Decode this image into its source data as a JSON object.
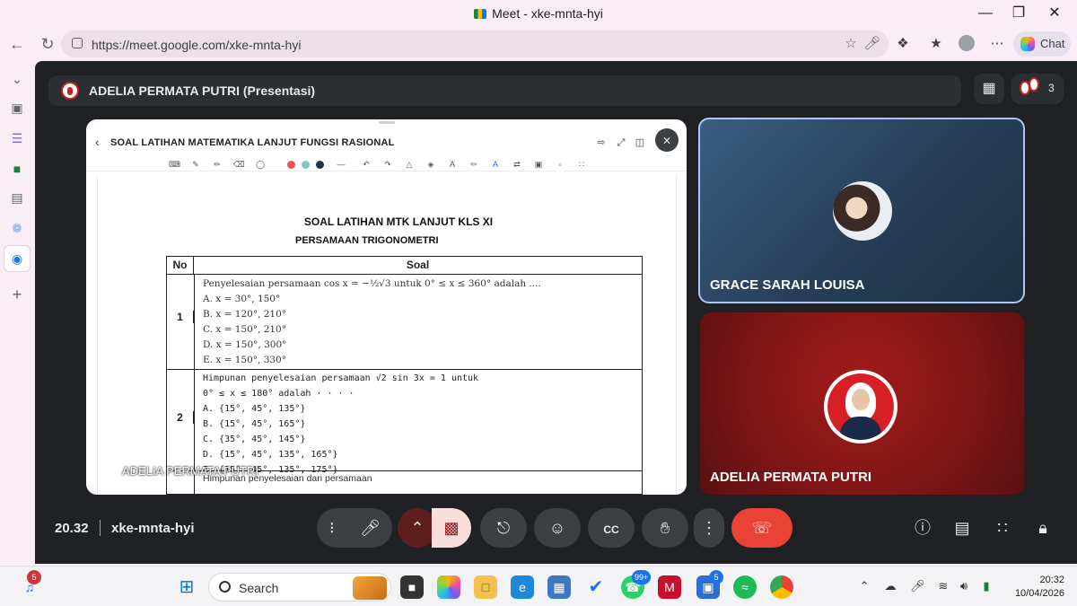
{
  "browser": {
    "tab_title": "Meet - xke-mnta-hyi",
    "url": "https://meet.google.com/xke-mnta-hyi",
    "chat_label": "Chat"
  },
  "meet": {
    "presenter_bar_title": "ADELIA PERMATA PUTRI (Presentasi)",
    "participant_count": "3",
    "time": "20.32",
    "meeting_code": "xke-mnta-hyi",
    "presentation_label": "ADELIA PERMATA PUTRI"
  },
  "document": {
    "title": "SOAL LATIHAN  MATEMATIKA LANJUT FUNGSI RASIONAL",
    "heading": "SOAL LATIHAN  MTK LANJUT KLS  XI",
    "subheading": "PERSAMAAN TRIGONOMETRI",
    "table_headers": {
      "no": "No",
      "soal": "Soal"
    },
    "questions": [
      {
        "no": "1",
        "stem": "Penyelesaian persamaan cos x = −½√3 untuk 0° ≤ x ≤ 360° adalah ....",
        "options": [
          "A. x = 30°, 150°",
          "B. x = 120°, 210°",
          "C. x = 150°, 210°",
          "D. x = 150°, 300°",
          "E. x = 150°, 330°"
        ]
      },
      {
        "no": "2",
        "stem": "Himpunan penyelesaian persamaan √2 sin 3x = 1 untuk",
        "stem2": "0° ≤ x ≤ 180° adalah · · · ·",
        "options": [
          "A. {15°, 45°, 135°}",
          "B. {15°, 45°, 165°}",
          "C. {35°, 45°, 145°}",
          "D. {15°, 45°, 135°, 165°}",
          "E. {15°, 45°, 135°, 175°}"
        ]
      }
    ],
    "next_question_fragment": "Himpunan penyelesaian dari persamaan",
    "pen_colors": [
      "#e8534f",
      "#7fc8c0",
      "#1f2f4a"
    ]
  },
  "tiles": [
    {
      "name": "GRACE SARAH LOUISA"
    },
    {
      "name": "ADELIA PERMATA PUTRI"
    }
  ],
  "taskbar": {
    "search_placeholder": "Search",
    "badges": {
      "edge_corner": "5",
      "whatsapp": "99+",
      "store": "5"
    },
    "clock_time": "20:32",
    "clock_date": "10/04/2026"
  },
  "colors": {
    "meet_bg": "#202124",
    "end_call": "#ea4335",
    "camera_off": "#f9dedc",
    "active_tile_border": "#a8c7fa"
  }
}
